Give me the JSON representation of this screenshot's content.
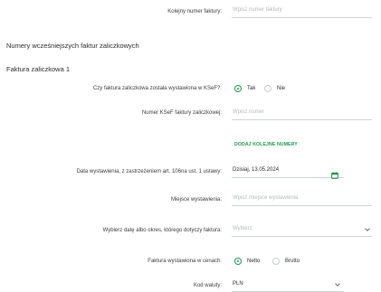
{
  "invoice_number": {
    "label": "Kolejny numer faktury:",
    "placeholder": "Wpisz numer faktury"
  },
  "previous_section_title": "Numery wcześniejszych faktur zaliczkowych",
  "advance_invoice_title": "Faktura zaliczkowa 1",
  "ksef_issued": {
    "label": "Czy faktura zaliczkowa została wystawiona w KSeF?:",
    "options": [
      "Tak",
      "Nie"
    ],
    "selected": "Tak"
  },
  "ksef_number": {
    "label": "Numer KSeF faktury zaliczkowej:",
    "placeholder": "Wpisz numer"
  },
  "add_numbers_link": "DODAJ KOLEJNE NUMERY",
  "issue_date": {
    "label": "Data wystawienia, z zastrzeżeniem art. 106na ust. 1 ustawy:",
    "value": "Dzisiaj, 13.05.2024",
    "icon": "calendar-icon"
  },
  "issue_place": {
    "label": "Miejsce wystawienia:",
    "placeholder": "Wpisz miejsce wystawienia"
  },
  "date_or_period": {
    "label": "Wybierz datę albo okres, którego dotyczy faktura:",
    "placeholder": "Wybierz"
  },
  "price_type": {
    "label": "Faktura wystawiona w cenach:",
    "options": [
      "Netto",
      "Brutto"
    ],
    "selected": "Netto"
  },
  "currency": {
    "label": "Kod waluty:",
    "value": "PLN"
  },
  "colors": {
    "accent": "#1d9a4a",
    "placeholder": "#b5b8bb",
    "divider": "#cfd3d6"
  }
}
